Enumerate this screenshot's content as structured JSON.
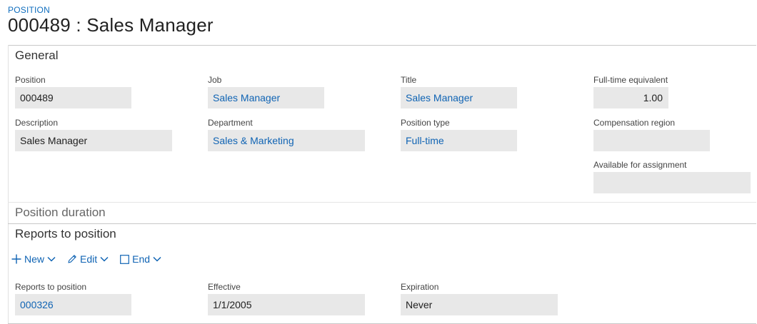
{
  "header": {
    "caption": "POSITION",
    "title": "000489 : Sales Manager"
  },
  "general": {
    "heading": "General",
    "position": {
      "label": "Position",
      "value": "000489"
    },
    "description": {
      "label": "Description",
      "value": "Sales Manager"
    },
    "job": {
      "label": "Job",
      "value": "Sales Manager"
    },
    "department": {
      "label": "Department",
      "value": "Sales & Marketing"
    },
    "title": {
      "label": "Title",
      "value": "Sales Manager"
    },
    "position_type": {
      "label": "Position type",
      "value": "Full-time"
    },
    "fte": {
      "label": "Full-time equivalent",
      "value": "1.00"
    },
    "compensation_region": {
      "label": "Compensation region",
      "value": ""
    },
    "available_for_assignment": {
      "label": "Available for assignment",
      "value": ""
    }
  },
  "position_duration": {
    "heading": "Position duration"
  },
  "reports_to": {
    "heading": "Reports to position",
    "toolbar": {
      "new_label": "New",
      "edit_label": "Edit",
      "end_label": "End"
    },
    "reports_to_position": {
      "label": "Reports to position",
      "value": "000326"
    },
    "effective": {
      "label": "Effective",
      "value": "1/1/2005"
    },
    "expiration": {
      "label": "Expiration",
      "value": "Never"
    }
  },
  "colors": {
    "accent": "#1064b4",
    "field_bg": "#e8e8e8",
    "divider": "#c8c8c8"
  },
  "icons": [
    "plus-icon",
    "chevron-down-icon",
    "pencil-icon",
    "checkbox-square-icon"
  ]
}
